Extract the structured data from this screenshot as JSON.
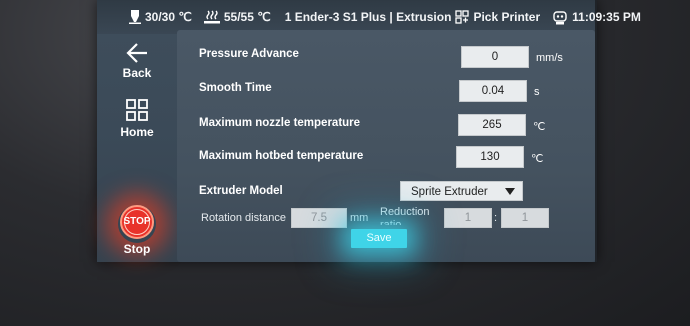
{
  "status": {
    "nozzle_temp": "30/30 ℃",
    "bed_temp": "55/55 ℃",
    "printer_name": "1 Ender-3 S1 Plus | Extrusion",
    "pick_printer": "Pick Printer",
    "time": "11:09:35 PM"
  },
  "sidebar": {
    "back": "Back",
    "home": "Home",
    "stop_icon_text": "STOP",
    "stop": "Stop"
  },
  "settings": {
    "pressure_advance": {
      "label": "Pressure Advance",
      "value": "0",
      "unit": "mm/s"
    },
    "smooth_time": {
      "label": "Smooth Time",
      "value": "0.04",
      "unit": "s"
    },
    "max_nozzle": {
      "label": "Maximum nozzle temperature",
      "value": "265",
      "unit": "℃"
    },
    "max_hotbed": {
      "label": "Maximum hotbed temperature",
      "value": "130",
      "unit": "℃"
    },
    "extruder_model": {
      "label": "Extruder Model",
      "value": "Sprite Extruder"
    },
    "rotation_distance": {
      "label": "Rotation distance",
      "value": "7.5",
      "unit": "mm"
    },
    "reduction": {
      "label": "Reduction",
      "label2": "ratio",
      "value_a": "1",
      "separator": ":",
      "value_b": "1"
    }
  },
  "save_label": "Save",
  "colors": {
    "accent": "#3fd4e8",
    "stop": "#e8322a"
  }
}
